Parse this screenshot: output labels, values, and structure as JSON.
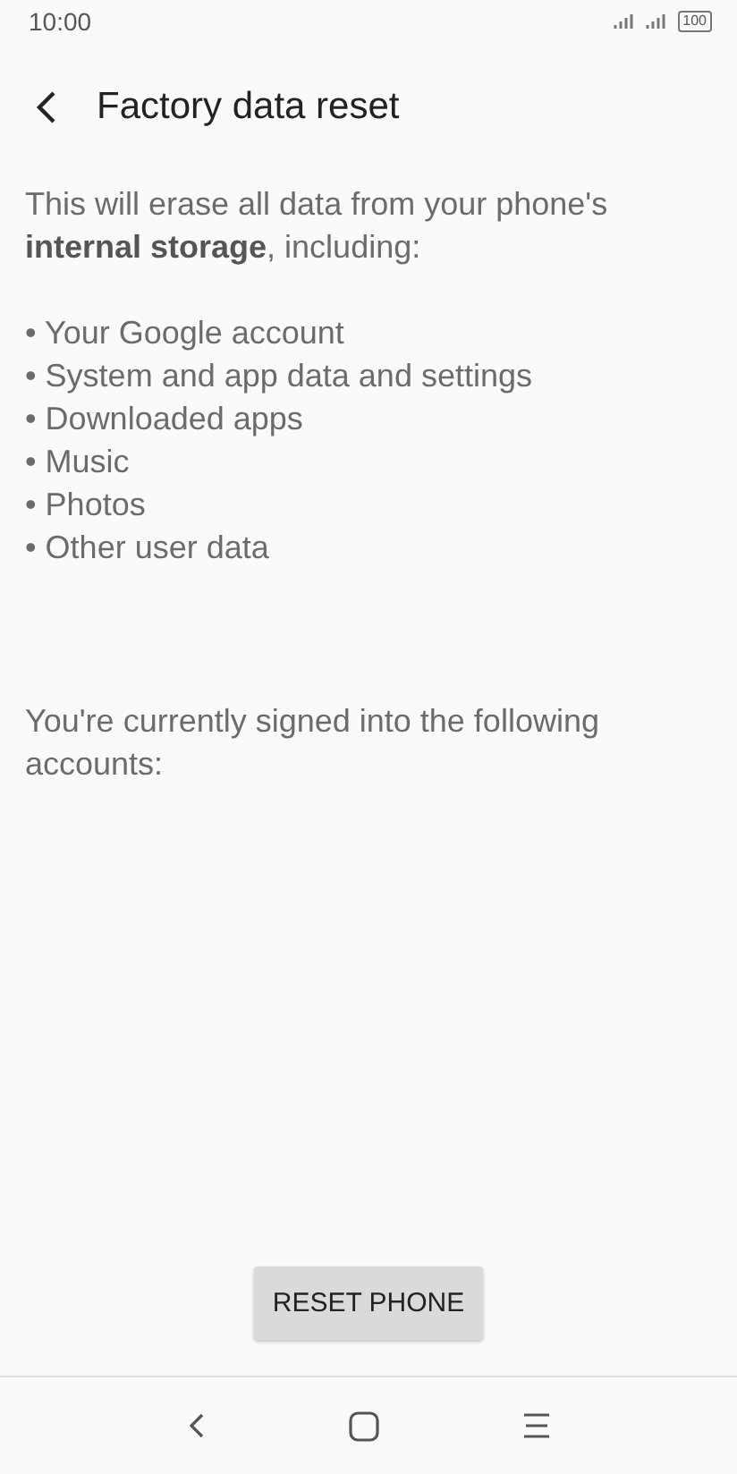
{
  "status_bar": {
    "time": "10:00",
    "battery": "100"
  },
  "header": {
    "title": "Factory data reset"
  },
  "intro": "This will erase all data from your phone's **internal storage**, including:",
  "items": [
    "• Your Google account",
    "• System and app data and settings",
    "• Downloaded apps",
    "• Music",
    "• Photos",
    "• Other user data"
  ],
  "accounts_note": "You're currently signed into the following accounts:",
  "button": "RESET PHONE"
}
